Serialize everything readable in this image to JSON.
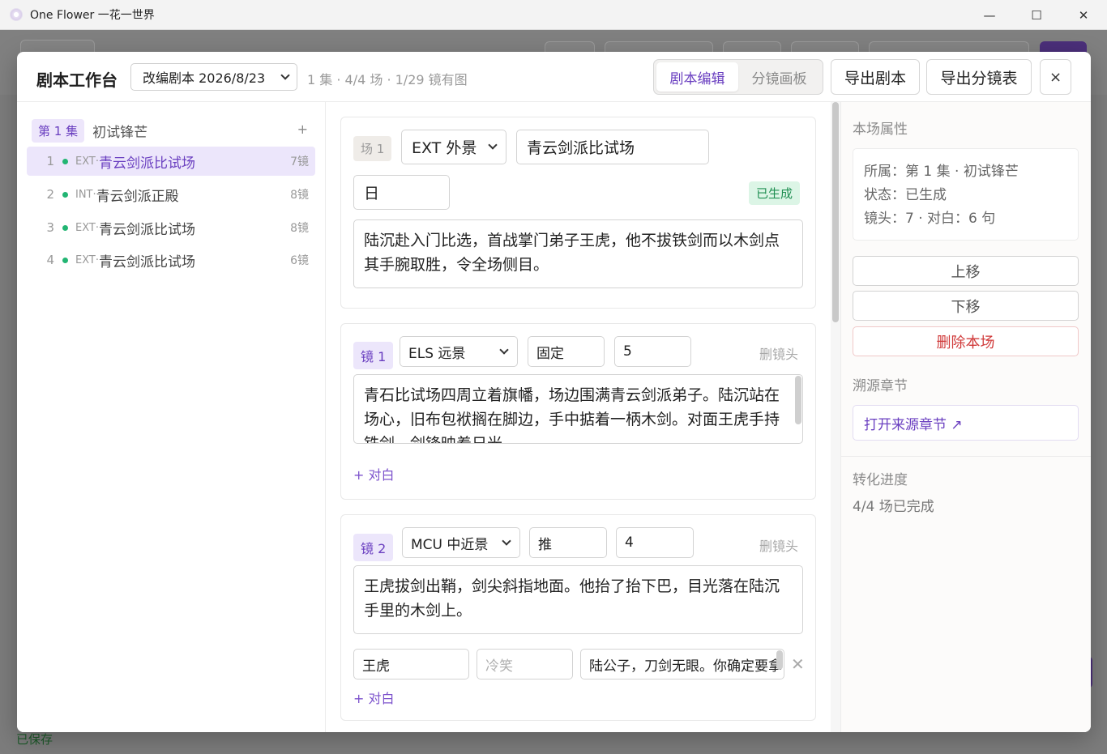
{
  "window": {
    "title": "One Flower 一花一世界",
    "minimize": "—",
    "maximize": "☐",
    "close": "✕"
  },
  "background": {
    "status": "已保存"
  },
  "header": {
    "title": "剧本工作台",
    "script_select": "改编剧本 2026/8/23",
    "stats": "1 集 · 4/4 场 · 1/29 镜有图",
    "tabs": [
      {
        "label": "剧本编辑",
        "active": true
      },
      {
        "label": "分镜画板",
        "active": false
      }
    ],
    "export_script": "导出剧本",
    "export_storyboard": "导出分镜表",
    "close": "×"
  },
  "sidebar": {
    "episode": {
      "badge": "第 1 集",
      "title": "初试锋芒",
      "add": "+"
    },
    "scenes": [
      {
        "num": "1",
        "type": "EXT·",
        "name": "青云剑派比试场",
        "count": "7镜",
        "active": true
      },
      {
        "num": "2",
        "type": "INT·",
        "name": "青云剑派正殿",
        "count": "8镜",
        "active": false
      },
      {
        "num": "3",
        "type": "EXT·",
        "name": "青云剑派比试场",
        "count": "8镜",
        "active": false
      },
      {
        "num": "4",
        "type": "EXT·",
        "name": "青云剑派比试场",
        "count": "6镜",
        "active": false
      }
    ]
  },
  "scene_card": {
    "tag": "场 1",
    "int_ext": "EXT 外景",
    "location": "青云剑派比试场",
    "time": "日",
    "status": "已生成",
    "summary": "陆沉赴入门比选，首战掌门弟子王虎，他不拔铁剑而以木剑点其手腕取胜，令全场侧目。"
  },
  "shots": [
    {
      "tag": "镜 1",
      "shot_size": "ELS 远景",
      "movement": "固定",
      "duration": "5",
      "delete": "删镜头",
      "description": "青石比试场四周立着旗幡，场边围满青云剑派弟子。陆沉站在场心，旧布包袱搁在脚边，手中掂着一柄木剑。对面王虎手持铁剑，剑锋映着日光。",
      "add_dialog": "+ 对白"
    },
    {
      "tag": "镜 2",
      "shot_size": "MCU 中近景",
      "movement": "推",
      "duration": "4",
      "delete": "删镜头",
      "description": "王虎拔剑出鞘，剑尖斜指地面。他抬了抬下巴，目光落在陆沉手里的木剑上。",
      "dialog": {
        "speaker": "王虎",
        "emotion_placeholder": "冷笑",
        "line": "陆公子，刀剑无眼。你确定要拿这个？",
        "remove": "✕"
      },
      "add_dialog": "+ 对白"
    }
  ],
  "right_panel": {
    "props_title": "本场属性",
    "props": [
      "所属：第 1 集 · 初试锋芒",
      "状态：已生成",
      "镜头：7 · 对白：6 句"
    ],
    "move_up": "上移",
    "move_down": "下移",
    "delete_scene": "删除本场",
    "source_title": "溯源章节",
    "source_link": "打开来源章节 ↗",
    "progress_title": "转化进度",
    "progress_text": "4/4 场已完成"
  }
}
